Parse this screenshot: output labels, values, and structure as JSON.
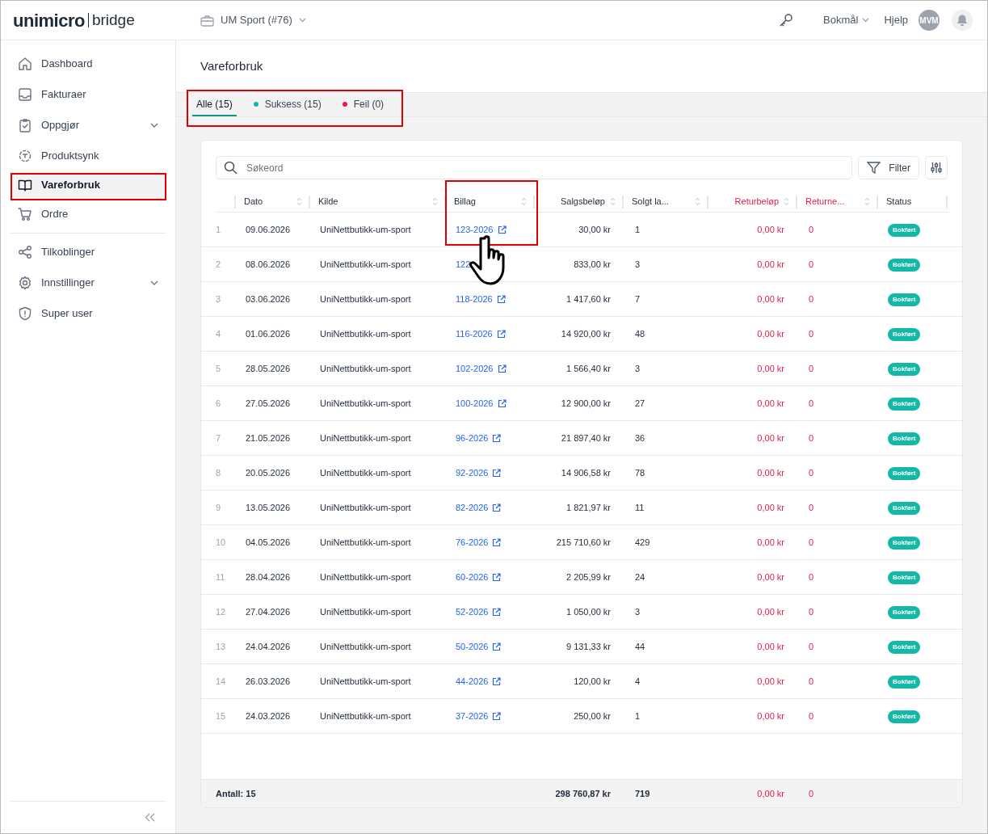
{
  "header": {
    "logo_word": "unimicro",
    "logo_sub": "bridge",
    "company": "UM Sport (#76)",
    "language": "Bokmål",
    "help": "Hjelp",
    "avatar": "MVM"
  },
  "sidebar": {
    "groups": [
      [
        {
          "label": "Dashboard",
          "selected": false,
          "expandable": false
        },
        {
          "label": "Fakturaer",
          "selected": false,
          "expandable": false
        },
        {
          "label": "Oppgjør",
          "selected": false,
          "expandable": true
        },
        {
          "label": "Produktsynk",
          "selected": false,
          "expandable": false
        },
        {
          "label": "Vareforbruk",
          "selected": true,
          "expandable": false
        },
        {
          "label": "Ordre",
          "selected": false,
          "expandable": false
        }
      ],
      [
        {
          "label": "Tilkoblinger",
          "selected": false,
          "expandable": false
        },
        {
          "label": "Innstillinger",
          "selected": false,
          "expandable": true
        },
        {
          "label": "Super user",
          "selected": false,
          "expandable": false
        }
      ]
    ]
  },
  "page_title": "Vareforbruk",
  "tabs": [
    {
      "label": "Alle (15)",
      "selected": true
    },
    {
      "label": "Suksess (15)",
      "selected": false,
      "color": "#14b8a6"
    },
    {
      "label": "Feil (0)",
      "selected": false,
      "color": "#e11d48"
    }
  ],
  "search": {
    "placeholder": "Søkeord"
  },
  "filter_button": "Filter",
  "table": {
    "columns": [
      {
        "label": "Dato",
        "kind": "text",
        "warn": false
      },
      {
        "label": "Kilde",
        "kind": "text",
        "warn": false
      },
      {
        "label": "Billag",
        "kind": "text",
        "warn": false
      },
      {
        "label": "Salgsbeløp",
        "kind": "amount",
        "warn": false
      },
      {
        "label": "Solgt la...",
        "kind": "text",
        "warn": false
      },
      {
        "label": "Returbeløp",
        "kind": "amount",
        "warn": true
      },
      {
        "label": "Returne...",
        "kind": "text",
        "warn": true
      },
      {
        "label": "Status",
        "kind": "text",
        "warn": false
      }
    ],
    "rows": [
      {
        "n": "1",
        "date": "09.06.2026",
        "source": "UniNettbutikk-um-sport",
        "voucher": "123-2026",
        "link_icon": true,
        "sales": "30,00 kr",
        "sold": "1",
        "ret_amount": "0,00 kr",
        "returned": "0",
        "status": "Bokført"
      },
      {
        "n": "2",
        "date": "08.06.2026",
        "source": "UniNettbutikk-um-sport",
        "voucher": "122",
        "link_icon": false,
        "sales": "833,00 kr",
        "sold": "3",
        "ret_amount": "0,00 kr",
        "returned": "0",
        "status": "Bokført"
      },
      {
        "n": "3",
        "date": "03.06.2026",
        "source": "UniNettbutikk-um-sport",
        "voucher": "118-2026",
        "link_icon": true,
        "sales": "1 417,60 kr",
        "sold": "7",
        "ret_amount": "0,00 kr",
        "returned": "0",
        "status": "Bokført"
      },
      {
        "n": "4",
        "date": "01.06.2026",
        "source": "UniNettbutikk-um-sport",
        "voucher": "116-2026",
        "link_icon": true,
        "sales": "14 920,00 kr",
        "sold": "48",
        "ret_amount": "0,00 kr",
        "returned": "0",
        "status": "Bokført"
      },
      {
        "n": "5",
        "date": "28.05.2026",
        "source": "UniNettbutikk-um-sport",
        "voucher": "102-2026",
        "link_icon": true,
        "sales": "1 566,40 kr",
        "sold": "3",
        "ret_amount": "0,00 kr",
        "returned": "0",
        "status": "Bokført"
      },
      {
        "n": "6",
        "date": "27.05.2026",
        "source": "UniNettbutikk-um-sport",
        "voucher": "100-2026",
        "link_icon": true,
        "sales": "12 900,00 kr",
        "sold": "27",
        "ret_amount": "0,00 kr",
        "returned": "0",
        "status": "Bokført"
      },
      {
        "n": "7",
        "date": "21.05.2026",
        "source": "UniNettbutikk-um-sport",
        "voucher": "96-2026",
        "link_icon": true,
        "sales": "21 897,40 kr",
        "sold": "36",
        "ret_amount": "0,00 kr",
        "returned": "0",
        "status": "Bokført"
      },
      {
        "n": "8",
        "date": "20.05.2026",
        "source": "UniNettbutikk-um-sport",
        "voucher": "92-2026",
        "link_icon": true,
        "sales": "14 906,58 kr",
        "sold": "78",
        "ret_amount": "0,00 kr",
        "returned": "0",
        "status": "Bokført"
      },
      {
        "n": "9",
        "date": "13.05.2026",
        "source": "UniNettbutikk-um-sport",
        "voucher": "82-2026",
        "link_icon": true,
        "sales": "1 821,97 kr",
        "sold": "11",
        "ret_amount": "0,00 kr",
        "returned": "0",
        "status": "Bokført"
      },
      {
        "n": "10",
        "date": "04.05.2026",
        "source": "UniNettbutikk-um-sport",
        "voucher": "76-2026",
        "link_icon": true,
        "sales": "215 710,60 kr",
        "sold": "429",
        "ret_amount": "0,00 kr",
        "returned": "0",
        "status": "Bokført"
      },
      {
        "n": "11",
        "date": "28.04.2026",
        "source": "UniNettbutikk-um-sport",
        "voucher": "60-2026",
        "link_icon": true,
        "sales": "2 205,99 kr",
        "sold": "24",
        "ret_amount": "0,00 kr",
        "returned": "0",
        "status": "Bokført"
      },
      {
        "n": "12",
        "date": "27.04.2026",
        "source": "UniNettbutikk-um-sport",
        "voucher": "52-2026",
        "link_icon": true,
        "sales": "1 050,00 kr",
        "sold": "3",
        "ret_amount": "0,00 kr",
        "returned": "0",
        "status": "Bokført"
      },
      {
        "n": "13",
        "date": "24.04.2026",
        "source": "UniNettbutikk-um-sport",
        "voucher": "50-2026",
        "link_icon": true,
        "sales": "9 131,33 kr",
        "sold": "44",
        "ret_amount": "0,00 kr",
        "returned": "0",
        "status": "Bokført"
      },
      {
        "n": "14",
        "date": "26.03.2026",
        "source": "UniNettbutikk-um-sport",
        "voucher": "44-2026",
        "link_icon": true,
        "sales": "120,00 kr",
        "sold": "4",
        "ret_amount": "0,00 kr",
        "returned": "0",
        "status": "Bokført"
      },
      {
        "n": "15",
        "date": "24.03.2026",
        "source": "UniNettbutikk-um-sport",
        "voucher": "37-2026",
        "link_icon": true,
        "sales": "250,00 kr",
        "sold": "1",
        "ret_amount": "0,00 kr",
        "returned": "0",
        "status": "Bokført"
      }
    ],
    "footer": {
      "count": "Antall: 15",
      "sales": "298 760,87 kr",
      "sold": "719",
      "ret_amount": "0,00 kr",
      "returned": "0"
    }
  }
}
